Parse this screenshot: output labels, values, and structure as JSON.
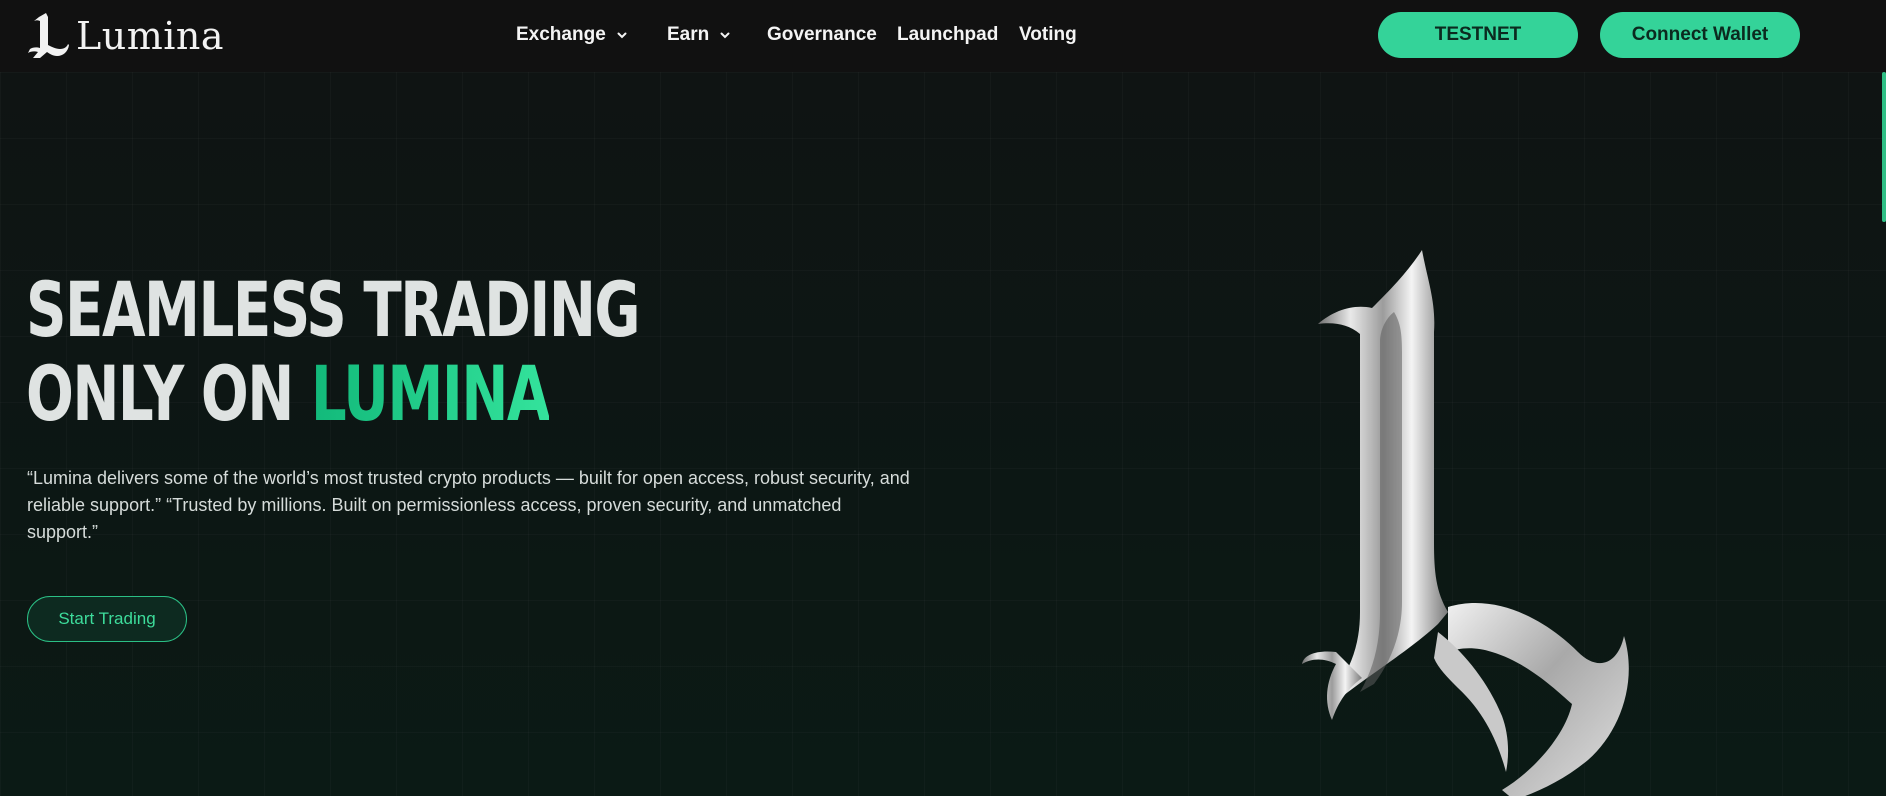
{
  "brand": {
    "name": "Lumina",
    "logo_icon": "lumina-logo-icon"
  },
  "nav": {
    "items": [
      {
        "label": "Exchange",
        "has_dropdown": true
      },
      {
        "label": "Earn",
        "has_dropdown": true
      },
      {
        "label": "Governance",
        "has_dropdown": false
      },
      {
        "label": "Launchpad",
        "has_dropdown": false
      },
      {
        "label": "Voting",
        "has_dropdown": false
      }
    ]
  },
  "header_actions": {
    "testnet_label": "TESTNET",
    "connect_label": "Connect Wallet"
  },
  "hero": {
    "headline_line1": "SEAMLESS TRADING",
    "headline_line2_prefix": "ONLY ON ",
    "headline_line2_accent": "LUMINA",
    "description": "“Lumina delivers some of the world’s most trusted crypto products — built for open access, robust security, and reliable support.” “Trusted by millions. Built on permissionless access, proven security, and unmatched support.”",
    "cta_label": "Start Trading",
    "art_icon": "silver-l-emblem"
  },
  "colors": {
    "background": "#0f1212",
    "header": "#111111",
    "accent": "#34d399",
    "accent_text": "#3ddc9b",
    "headline": "#dfe3e2"
  }
}
